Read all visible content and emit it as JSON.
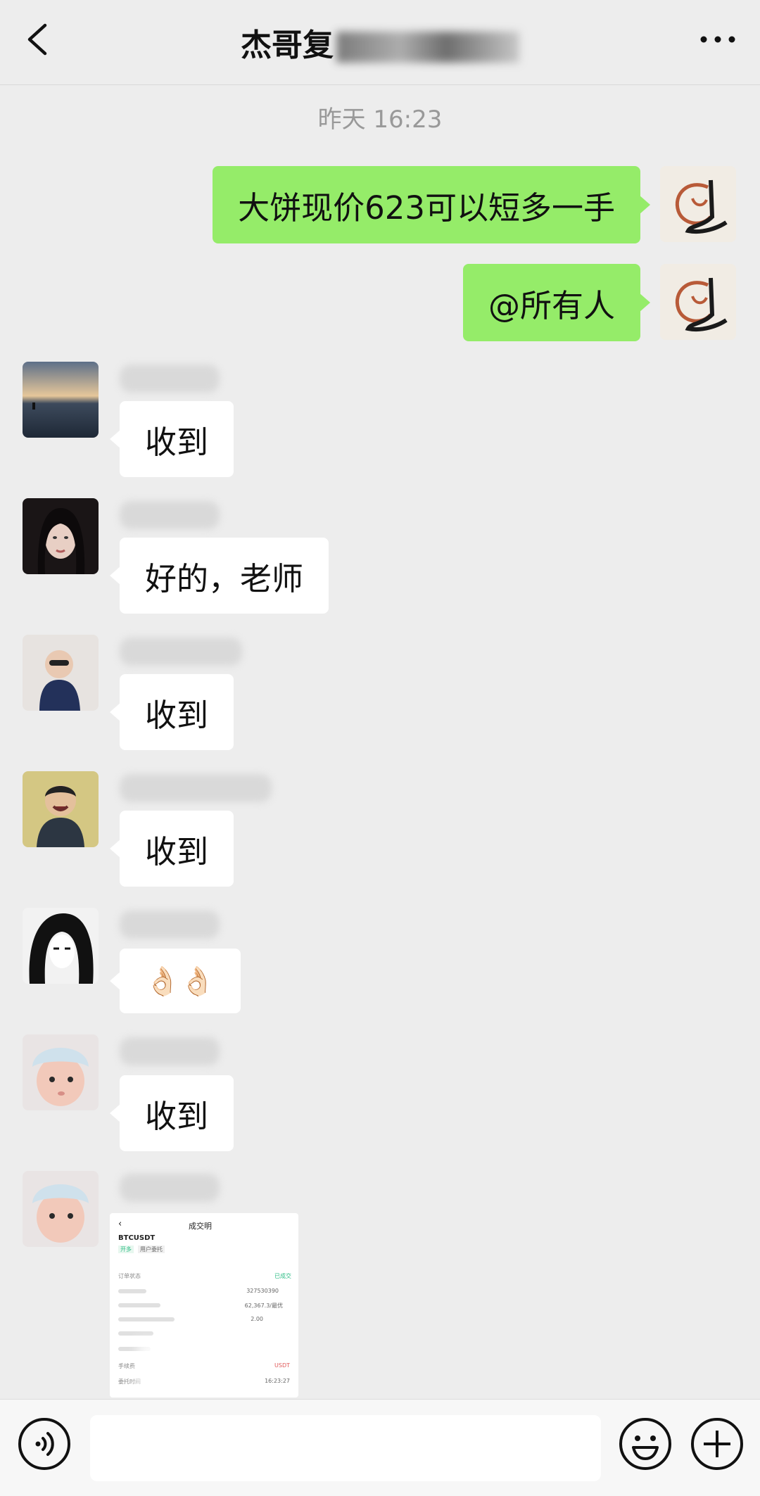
{
  "header": {
    "title": "杰哥复",
    "back_icon": "chevron-left-icon",
    "more_icon": "more-icon"
  },
  "timestamp": "昨天 16:23",
  "messages": [
    {
      "from": "me",
      "text": "大饼现价623可以短多一手"
    },
    {
      "from": "me",
      "text": "@所有人"
    },
    {
      "from": "other",
      "text": "收到"
    },
    {
      "from": "other",
      "text": "好的，老师"
    },
    {
      "from": "other",
      "text": "收到"
    },
    {
      "from": "other",
      "text": "收到"
    },
    {
      "from": "other",
      "text": "👌🏻👌🏻"
    },
    {
      "from": "other",
      "text": "收到"
    },
    {
      "from": "other",
      "image": "trade-screenshot"
    }
  ],
  "screenshot": {
    "page_title": "成交明",
    "pair": "BTCUSDT",
    "tags": [
      "开多",
      "用户委托"
    ],
    "status": "已成交",
    "order_fragment": "327530390",
    "price_fragment": "62,367.3/最优",
    "qty_fragment": "2.00",
    "fee_label": "手续费",
    "fee_value": "USDT",
    "time_label": "委托时间",
    "time_value": "16:23:27",
    "order_label": "订单状态"
  },
  "input": {
    "voice_icon": "voice-icon",
    "emoji_icon": "emoji-icon",
    "plus_icon": "plus-icon",
    "placeholder": ""
  },
  "colors": {
    "background": "#ededed",
    "my_bubble": "#95ec69",
    "other_bubble": "#ffffff",
    "timestamp_text": "#999999"
  }
}
